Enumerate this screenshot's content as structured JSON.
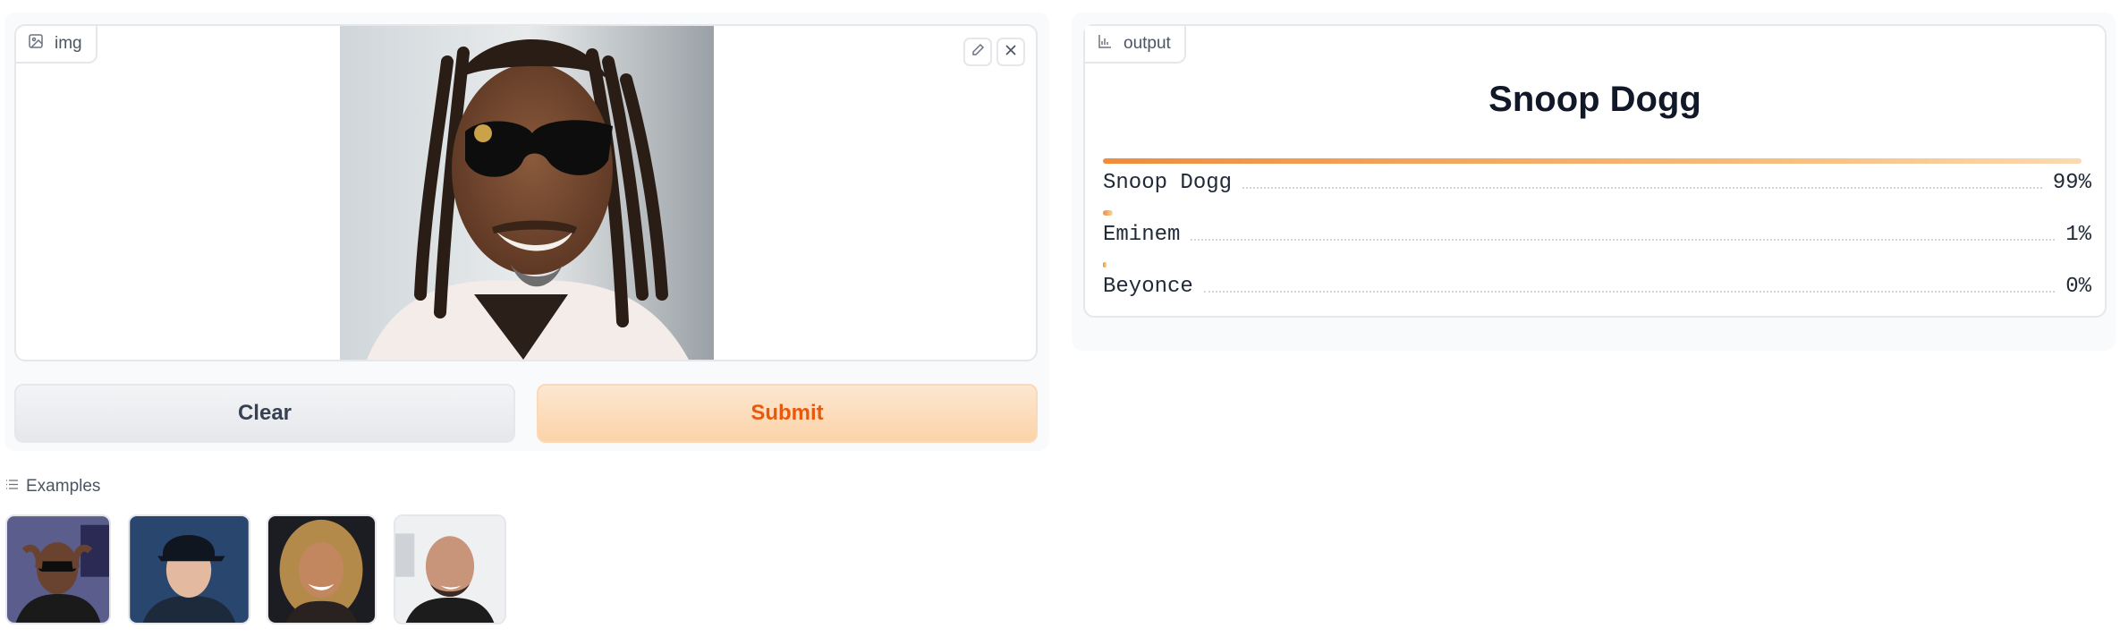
{
  "input": {
    "label": "img",
    "label_icon": "image-icon",
    "edit_icon": "pencil-icon",
    "clear_icon": "close-icon"
  },
  "buttons": {
    "clear_label": "Clear",
    "submit_label": "Submit",
    "submit_color": "#ea580c"
  },
  "output": {
    "label": "output",
    "label_icon": "chart-icon",
    "top_label": "Snoop Dogg",
    "confidences": [
      {
        "label": "Snoop Dogg",
        "percent": "99%",
        "value": 0.99
      },
      {
        "label": "Eminem",
        "percent": "1%",
        "value": 0.01
      },
      {
        "label": "Beyonce",
        "percent": "0%",
        "value": 0.0
      }
    ],
    "accent_color": "#f08c3c"
  },
  "examples": {
    "label": "Examples",
    "label_icon": "list-icon",
    "count": 4
  }
}
